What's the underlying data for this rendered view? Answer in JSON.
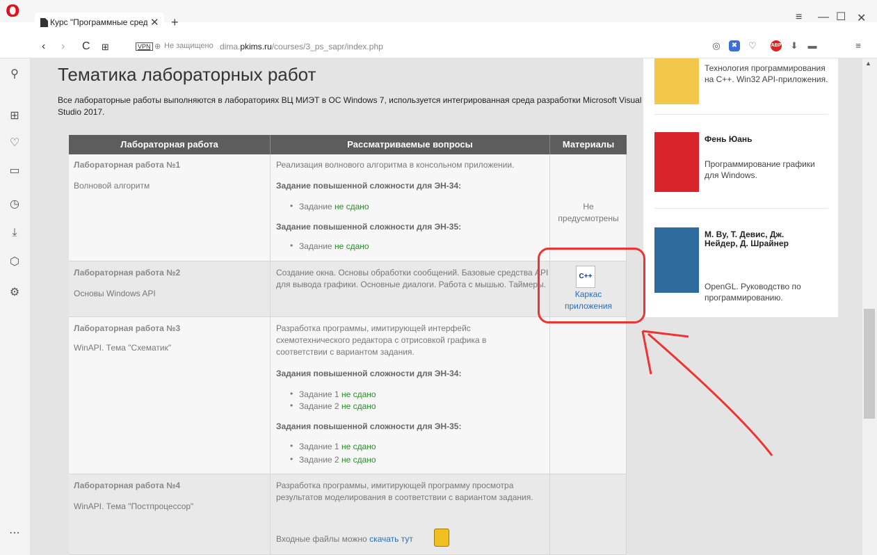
{
  "browser": {
    "logo": "O",
    "tab_title": "Курс \"Программные сред",
    "tab_close": "✕",
    "tab_add": "+",
    "vpn_label": "VPN",
    "security_text": "Не защищено",
    "url_host_prefix": "dima.",
    "url_host_main": "pkims.ru",
    "url_path": "/courses/3_ps_sapr/index.php"
  },
  "page": {
    "title": "Тематика лабораторных работ",
    "description": "Все лабораторные работы выполняются в лабораториях ВЦ МИЭТ в ОС Windows 7, используется интегрированная среда разработки Microsoft Visual Studio 2017."
  },
  "table": {
    "headers": [
      "Лабораторная работа",
      "Рассматриваемые вопросы",
      "Материалы"
    ],
    "lab1": {
      "title": "Лабораторная работа №1",
      "subtitle": "Волновой алгоритм",
      "desc": "Реализация волнового алгоритма в консольном приложении.",
      "hard34": "Задание повышенной сложности для ЭН-34",
      "task_prefix": "Задание ",
      "status": "не сдано",
      "hard35": "Задание повышенной сложности для ЭН-35",
      "materials": "Не предусмотрены"
    },
    "lab2": {
      "title": "Лабораторная работа №2",
      "subtitle": "Основы Windows API",
      "desc": "Создание окна. Основы обработки сообщений. Базовые средства API для вывода графики. Основные диалоги. Работа с мышью. Таймеры.",
      "material_icon": "C++",
      "material_link": "Каркас приложения"
    },
    "lab3": {
      "title": "Лабораторная работа №3",
      "subtitle": "WinAPI. Тема \"Схематик\"",
      "desc": "Разработка программы, имитирующей интерфейс схемотехнического редактора с отрисовкой графика в соответствии с вариантом задания.",
      "hard34": "Задания повышенной сложности для ЭН-34",
      "hard35": "Задания повышенной сложности для ЭН-35",
      "task1": "Задание 1 ",
      "task2": "Задание 2 ",
      "status": "не сдано"
    },
    "lab4": {
      "title": "Лабораторная работа №4",
      "subtitle": "WinAPI. Тема \"Постпроцессор\"",
      "desc": "Разработка программы, имитирующей программу просмотра результатов моделирования в соответствии с вариантом задания.",
      "files_text": "Входные файлы можно ",
      "files_link": "скачать тут"
    }
  },
  "books": [
    {
      "author": "",
      "desc": "Технология программирования на С++. Win32 API-приложения."
    },
    {
      "author": "Фень Юань",
      "desc": "Программирование графики для Windows."
    },
    {
      "author": "М. Ву, Т. Девис, Дж. Нейдер, Д. Шрайнер",
      "desc": "OpenGL. Руководство по программированию."
    }
  ],
  "colors": {
    "annotation": "#e33333",
    "header_bg": "#5d5d5d",
    "link": "#2c6fb3",
    "status_green": "#2a8a2a"
  }
}
